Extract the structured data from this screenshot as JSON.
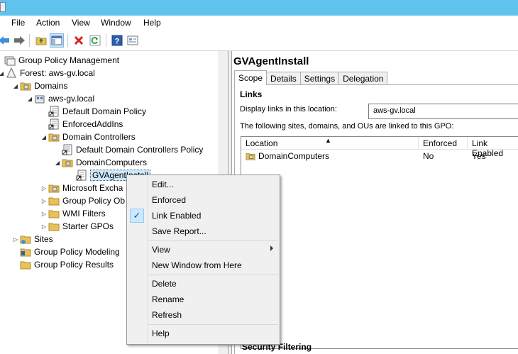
{
  "menubar": {
    "items": [
      "File",
      "Action",
      "View",
      "Window",
      "Help"
    ]
  },
  "toolbar": {
    "buttons": [
      "back-icon",
      "forward-icon",
      "up-folder-icon",
      "show-hide-tree-icon",
      "delete-icon",
      "refresh-icon",
      "help-icon",
      "properties-icon"
    ]
  },
  "tree": {
    "root": "Group Policy Management",
    "forest": "Forest: aws-gv.local",
    "domains": "Domains",
    "domain": "aws-gv.local",
    "default_domain_policy": "Default Domain Policy",
    "enforced_addins": "EnforcedAddIns",
    "domain_controllers": "Domain Controllers",
    "default_dc_policy": "Default Domain Controllers Policy",
    "domain_computers": "DomainComputers",
    "gvagentinstall": "GVAgentInstall",
    "microsoft_exchange": "Microsoft Excha",
    "group_policy_objects": "Group Policy Ob",
    "wmi_filters": "WMI Filters",
    "starter_gpos": "Starter GPOs",
    "sites": "Sites",
    "gp_modeling": "Group Policy Modeling",
    "gp_results": "Group Policy Results"
  },
  "details": {
    "title": "GVAgentInstall",
    "tabs": [
      "Scope",
      "Details",
      "Settings",
      "Delegation"
    ],
    "links_heading": "Links",
    "display_links_label": "Display links in this location:",
    "location_value": "aws-gv.local",
    "linked_text": "The following sites, domains, and OUs are linked to this GPO:",
    "columns": [
      "Location",
      "Enforced",
      "Link Enabled"
    ],
    "rows": [
      {
        "location": "DomainComputers",
        "enforced": "No",
        "link_enabled": "Yes"
      }
    ],
    "security_heading": "Security Filtering"
  },
  "context_menu": {
    "edit": "Edit...",
    "enforced": "Enforced",
    "link_enabled": "Link Enabled",
    "link_enabled_checked": true,
    "save_report": "Save Report...",
    "view": "View",
    "new_window": "New Window from Here",
    "delete": "Delete",
    "rename": "Rename",
    "refresh": "Refresh",
    "help": "Help"
  },
  "colors": {
    "titlebar": "#5fc3ee",
    "selection": "#cce8ff",
    "folder": "#e8c15a"
  }
}
